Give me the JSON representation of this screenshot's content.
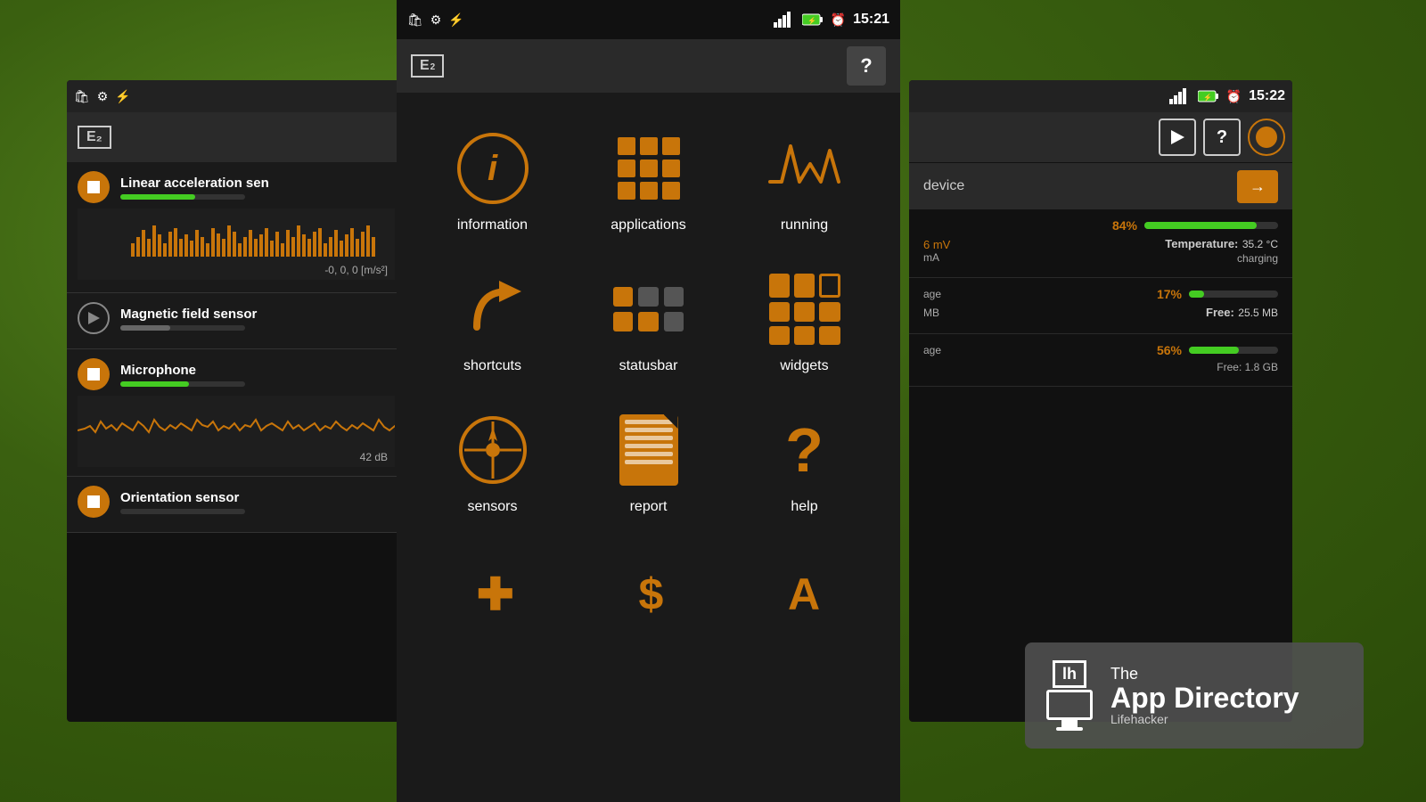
{
  "background": {
    "color": "#3a5a1a"
  },
  "left_panel": {
    "status_bar": {
      "icons": [
        "bag-icon",
        "android-icon",
        "usb-icon"
      ]
    },
    "app_logo": "E₂",
    "sensors": [
      {
        "name": "Linear acceleration sen",
        "state": "stop",
        "bar_width": "60%",
        "bar_type": "green",
        "has_chart": true,
        "chart_label": "-0, 0, 0 [m/s²]"
      },
      {
        "name": "Magnetic field sensor",
        "state": "play",
        "bar_width": "40%",
        "bar_type": "gray",
        "has_chart": false
      },
      {
        "name": "Microphone",
        "state": "stop",
        "bar_width": "55%",
        "bar_type": "green",
        "has_waveform": true,
        "waveform_label": "42 dB"
      },
      {
        "name": "Orientation sensor",
        "state": "stop",
        "bar_width": "0",
        "bar_type": "green"
      }
    ]
  },
  "center_panel": {
    "status_bar": {
      "icons": [
        "bag-icon",
        "android-icon",
        "usb-icon"
      ],
      "signal_bars": "signal-icon",
      "battery": "battery-charging-icon",
      "clock_icon": "alarm-icon",
      "time": "15:21"
    },
    "header": {
      "logo": "E₂",
      "help_label": "?"
    },
    "menu_items": [
      {
        "id": "information",
        "label": "information",
        "icon_type": "info-circle"
      },
      {
        "id": "applications",
        "label": "applications",
        "icon_type": "apps-grid"
      },
      {
        "id": "running",
        "label": "running",
        "icon_type": "waveform"
      },
      {
        "id": "shortcuts",
        "label": "shortcuts",
        "icon_type": "arrow-curve"
      },
      {
        "id": "statusbar",
        "label": "statusbar",
        "icon_type": "status-bars"
      },
      {
        "id": "widgets",
        "label": "widgets",
        "icon_type": "widgets-grid"
      },
      {
        "id": "sensors",
        "label": "sensors",
        "icon_type": "compass"
      },
      {
        "id": "report",
        "label": "report",
        "icon_type": "document"
      },
      {
        "id": "help",
        "label": "help",
        "icon_type": "question"
      }
    ],
    "bottom_partial_icons": [
      "+",
      "$",
      "A"
    ]
  },
  "right_panel": {
    "status_bar": {
      "signal": "signal-icon",
      "battery": "battery-charging-icon",
      "alarm": "alarm-icon",
      "time": "15:22"
    },
    "header_buttons": [
      {
        "id": "play",
        "label": "▶",
        "style": "outline"
      },
      {
        "id": "help",
        "label": "?",
        "style": "outline"
      },
      {
        "id": "circle",
        "label": "",
        "style": "orange-circle"
      }
    ],
    "device_label": "device",
    "device_arrow": "→",
    "sections": [
      {
        "id": "battery",
        "percent": "84%",
        "bar_width": "84%",
        "mv": "6 mV",
        "ma": "mA",
        "temperature_label": "Temperature:",
        "temperature_value": "35.2 °C",
        "charging": "charging"
      },
      {
        "id": "storage1",
        "label": "age",
        "percent": "17%",
        "bar_width": "17%",
        "mb_label": "MB",
        "free_label": "Free:",
        "free_value": "25.5 MB"
      },
      {
        "id": "storage2",
        "label": "age",
        "percent": "56%",
        "bar_width": "56%",
        "free_label": "Free: 1.8 GB"
      }
    ]
  },
  "app_directory_card": {
    "lh_text": "lh",
    "the_text": "The",
    "title": "App Directory",
    "subtitle": "Lifehacker"
  }
}
